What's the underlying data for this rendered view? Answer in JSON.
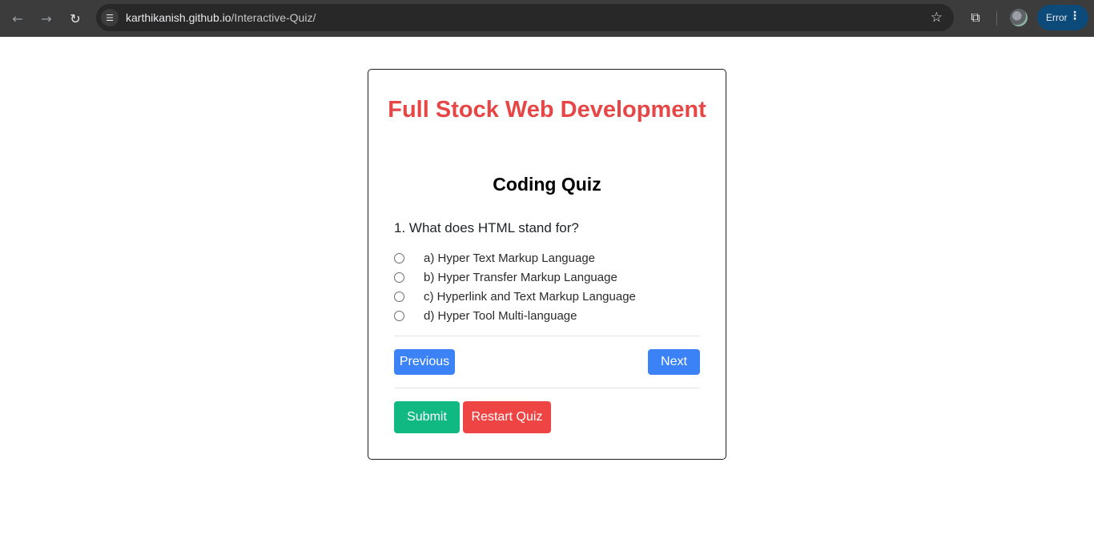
{
  "browser": {
    "url_host": "karthikanish.github.io",
    "url_path": "/Interactive-Quiz/",
    "profile_status": "Error",
    "icons": {
      "back": "arrow-left-icon",
      "forward": "arrow-right-icon",
      "reload": "reload-icon",
      "site_info": "tune-icon",
      "bookmark": "star-icon",
      "extensions": "puzzle-icon",
      "menu": "more-vert-icon"
    }
  },
  "quiz": {
    "title": "Full Stock Web Development",
    "subtitle": "Coding Quiz",
    "question": "1. What does HTML stand for?",
    "options": [
      "a) Hyper Text Markup Language",
      "b) Hyper Transfer Markup Language",
      "c) Hyperlink and Text Markup Language",
      "d) Hyper Tool Multi-language"
    ],
    "buttons": {
      "previous": "Previous",
      "next": "Next",
      "submit": "Submit",
      "restart": "Restart Quiz"
    },
    "colors": {
      "title": "#e64646",
      "nav_button": "#3b82f6",
      "submit_button": "#10b981",
      "restart_button": "#ef4444"
    }
  }
}
